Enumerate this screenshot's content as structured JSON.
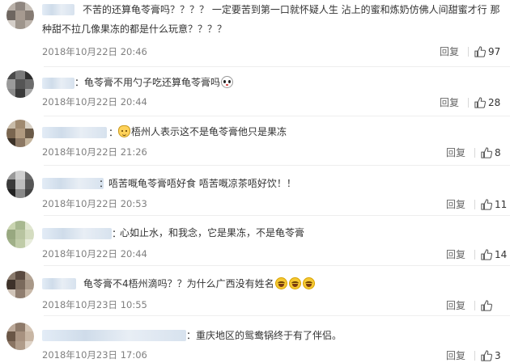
{
  "colors": {
    "text": "#333333",
    "time": "#808080",
    "reply": "#666666",
    "like_icon": "#555555"
  },
  "comments": [
    {
      "text_line1": "不苦的还算龟苓膏吗？？？？ 一定要苦到第一口就怀疑人生 沾上的蜜和炼奶仿佛人间甜蜜才行 那",
      "text_line2": "种甜不拉几像果冻的都是什么玩意？？？？",
      "time": "2018年10月22日 20:46",
      "reply": "回复",
      "likes": "97",
      "emojis": []
    },
    {
      "text": "：龟苓膏不用勺子吃还算龟苓膏吗",
      "time": "2018年10月22日 20:44",
      "reply": "回复",
      "likes": "28",
      "emojis": [
        "panda-emoji"
      ]
    },
    {
      "text": "梧州人表示这不是龟苓膏他只是果冻",
      "time": "2018年10月22日 21:26",
      "reply": "回复",
      "likes": "8",
      "emojis": [
        "cat-emoji"
      ]
    },
    {
      "text": "：唔苦嘅龟苓膏唔好食 唔苦嘅凉茶唔好饮！！",
      "time": "2018年10月22日 20:53",
      "reply": "回复",
      "likes": "11",
      "emojis": []
    },
    {
      "text": "心如止水，和我念，它是果冻，不是龟苓膏",
      "time": "2018年10月22日 20:44",
      "reply": "回复",
      "likes": "14",
      "emojis": []
    },
    {
      "text": "龟苓膏不4梧州滴吗？？为什么广西没有姓名",
      "time": "2018年10月23日 10:55",
      "reply": "回复",
      "likes": "",
      "emojis": [
        "laugh-emoji",
        "laugh-emoji",
        "laugh-emoji"
      ]
    },
    {
      "text": "：重庆地区的鸳鸯锅终于有了伴侣。",
      "time": "2018年10月23日 17:06",
      "reply": "回复",
      "likes": "3",
      "emojis": []
    }
  ]
}
